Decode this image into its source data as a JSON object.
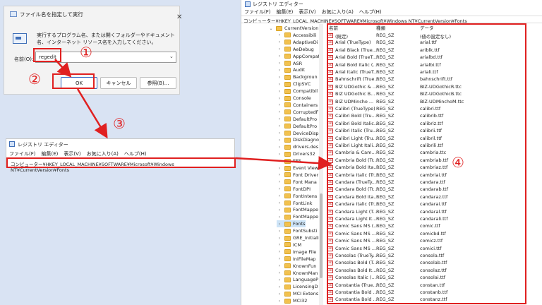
{
  "run_dialog": {
    "title": "ファイル名を指定して実行",
    "close_glyph": "✕",
    "description": "実行するプログラム名、または開くフォルダーやドキュメント名、インターネット リソース名を入力してください。",
    "name_label": "名前(O):",
    "name_value": "regedit",
    "ok_label": "OK",
    "cancel_label": "キャンセル",
    "browse_label": "参照(B)...",
    "dropdown_glyph": "⌄"
  },
  "annotations": {
    "n1": "①",
    "n2": "②",
    "n3": "③",
    "n4": "④",
    "color": "#e02020"
  },
  "mini_registry": {
    "title": "レジストリ エディター",
    "menu": [
      "ファイル(F)",
      "編集(E)",
      "表示(V)",
      "お気に入り(A)",
      "ヘルプ(H)"
    ],
    "path": "コンピューター¥HKEY_LOCAL_MACHINE¥SOFTWARE¥Microsoft¥Windows NT¥CurrentVersion¥Fonts"
  },
  "registry": {
    "title": "レジストリ エディター",
    "menu": [
      "ファイル(F)",
      "編集(E)",
      "表示(V)",
      "お気に入り(A)",
      "ヘルプ(H)"
    ],
    "address": "コンピューター¥HKEY_LOCAL_MACHINE¥SOFTWARE¥Microsoft¥Windows NT¥CurrentVersion¥Fonts",
    "tree": [
      "CurrentVersion",
      "Accessibili",
      "AdaptiveDi",
      "AeDebug",
      "AppCompat",
      "ASR",
      "Audit",
      "Backgroun",
      "ClipSVC",
      "Compatibil",
      "Console",
      "Containers",
      "CorruptedF",
      "DefaultPro",
      "DefaultPro",
      "DeviceDisp",
      "DiskDiagno",
      "drivers.des",
      "Drivers32",
      "EFS",
      "Event View",
      "Font Driver",
      "Font Mana",
      "FontDPI",
      "FontIntens",
      "FontLink",
      "FontMappe",
      "FontMappe",
      "Fonts",
      "FontSubsti",
      "GRE_Initiali",
      "ICM",
      "Image File",
      "IniFileMap",
      "KnownFun",
      "KnownMan",
      "LanguageP",
      "LicensingD",
      "MCI Extens",
      "MCI32"
    ],
    "columns": {
      "name": "名前",
      "type": "種類",
      "data": "データ"
    },
    "rows": [
      {
        "n": "(既定)",
        "t": "REG_SZ",
        "d": "(値の設定なし)"
      },
      {
        "n": "Arial (TrueType)",
        "t": "REG_SZ",
        "d": "arial.ttf"
      },
      {
        "n": "Arial Black (True...",
        "t": "REG_SZ",
        "d": "ariblk.ttf"
      },
      {
        "n": "Arial Bold (TrueT...",
        "t": "REG_SZ",
        "d": "arialbd.ttf"
      },
      {
        "n": "Arial Bold Italic (...",
        "t": "REG_SZ",
        "d": "arialbi.ttf"
      },
      {
        "n": "Arial Italic (TrueT...",
        "t": "REG_SZ",
        "d": "ariali.ttf"
      },
      {
        "n": "Bahnschrift (True...",
        "t": "REG_SZ",
        "d": "bahnschrift.ttf"
      },
      {
        "n": "BIZ UDGothic & ...",
        "t": "REG_SZ",
        "d": "BIZ-UDGothicR.ttc"
      },
      {
        "n": "BIZ UDGothic B...",
        "t": "REG_SZ",
        "d": "BIZ-UDGothicB.ttc"
      },
      {
        "n": "BIZ UDMincho ...",
        "t": "REG_SZ",
        "d": "BIZ-UDMinchoM.ttc"
      },
      {
        "n": "Calibri (TrueType)",
        "t": "REG_SZ",
        "d": "calibri.ttf"
      },
      {
        "n": "Calibri Bold (Tru...",
        "t": "REG_SZ",
        "d": "calibrib.ttf"
      },
      {
        "n": "Calibri Bold Italic...",
        "t": "REG_SZ",
        "d": "calibriz.ttf"
      },
      {
        "n": "Calibri Italic (Tru...",
        "t": "REG_SZ",
        "d": "calibrii.ttf"
      },
      {
        "n": "Calibri Light (Tru...",
        "t": "REG_SZ",
        "d": "calibril.ttf"
      },
      {
        "n": "Calibri Light Itali...",
        "t": "REG_SZ",
        "d": "calibrili.ttf"
      },
      {
        "n": "Cambria & Cam...",
        "t": "REG_SZ",
        "d": "cambria.ttc"
      },
      {
        "n": "Cambria Bold (Tr...",
        "t": "REG_SZ",
        "d": "cambriab.ttf"
      },
      {
        "n": "Cambria Bold Ita...",
        "t": "REG_SZ",
        "d": "cambriaz.ttf"
      },
      {
        "n": "Cambria Italic (Tr...",
        "t": "REG_SZ",
        "d": "cambriai.ttf"
      },
      {
        "n": "Candara (TrueTy...",
        "t": "REG_SZ",
        "d": "candara.ttf"
      },
      {
        "n": "Candara Bold (Tr...",
        "t": "REG_SZ",
        "d": "candarab.ttf"
      },
      {
        "n": "Candara Bold Ita...",
        "t": "REG_SZ",
        "d": "candaraz.ttf"
      },
      {
        "n": "Candara Italic (Tr...",
        "t": "REG_SZ",
        "d": "candarai.ttf"
      },
      {
        "n": "Candara Light (T...",
        "t": "REG_SZ",
        "d": "candaral.ttf"
      },
      {
        "n": "Candara Light It...",
        "t": "REG_SZ",
        "d": "candarali.ttf"
      },
      {
        "n": "Comic Sans MS (...",
        "t": "REG_SZ",
        "d": "comic.ttf"
      },
      {
        "n": "Comic Sans MS ...",
        "t": "REG_SZ",
        "d": "comicbd.ttf"
      },
      {
        "n": "Comic Sans MS ...",
        "t": "REG_SZ",
        "d": "comicz.ttf"
      },
      {
        "n": "Comic Sans MS ...",
        "t": "REG_SZ",
        "d": "comici.ttf"
      },
      {
        "n": "Consolas (TrueTy...",
        "t": "REG_SZ",
        "d": "consola.ttf"
      },
      {
        "n": "Consolas Bold (T...",
        "t": "REG_SZ",
        "d": "consolab.ttf"
      },
      {
        "n": "Consolas Bold It...",
        "t": "REG_SZ",
        "d": "consolaz.ttf"
      },
      {
        "n": "Consolas Italic (...",
        "t": "REG_SZ",
        "d": "consolai.ttf"
      },
      {
        "n": "Constantia (True...",
        "t": "REG_SZ",
        "d": "constan.ttf"
      },
      {
        "n": "Constantia Bold ...",
        "t": "REG_SZ",
        "d": "constanb.ttf"
      },
      {
        "n": "Constantia Bold ...",
        "t": "REG_SZ",
        "d": "constanz.ttf"
      }
    ]
  }
}
